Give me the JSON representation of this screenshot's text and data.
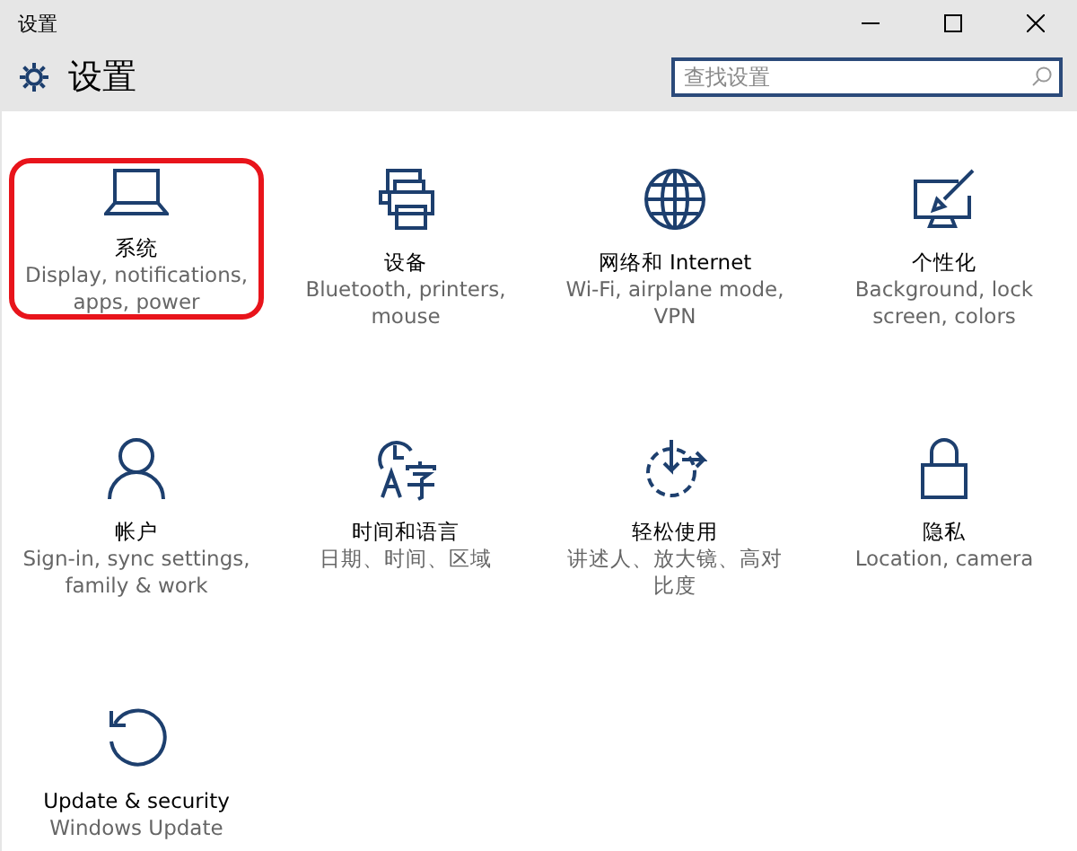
{
  "window": {
    "title": "设置",
    "controls": [
      {
        "kind": "minimize"
      },
      {
        "kind": "maximize"
      },
      {
        "kind": "close"
      }
    ]
  },
  "header": {
    "title": "设置",
    "search": {
      "placeholder": "查找设置"
    }
  },
  "tiles": [
    {
      "kind": "laptop",
      "title": "系统",
      "description": "Display, notifications, apps, power",
      "highlighted": true
    },
    {
      "kind": "printer",
      "title": "设备",
      "description": "Bluetooth, printers, mouse",
      "highlighted": false
    },
    {
      "kind": "globe",
      "title": "网络和 Internet",
      "description": "Wi-Fi, airplane mode, VPN",
      "highlighted": false
    },
    {
      "kind": "paint",
      "title": "个性化",
      "description": "Background, lock screen, colors",
      "highlighted": false
    },
    {
      "kind": "person",
      "title": "帐户",
      "description": "Sign-in, sync settings, family & work",
      "highlighted": false
    },
    {
      "kind": "timelang",
      "title": "时间和语言",
      "description": "日期、时间、区域",
      "highlighted": false
    },
    {
      "kind": "ease",
      "title": "轻松使用",
      "description": "讲述人、放大镜、高对比度",
      "highlighted": false
    },
    {
      "kind": "lock",
      "title": "隐私",
      "description": "Location, camera",
      "highlighted": false
    },
    {
      "kind": "update",
      "title": "Update & security",
      "description": "Windows Update",
      "highlighted": false
    }
  ]
}
